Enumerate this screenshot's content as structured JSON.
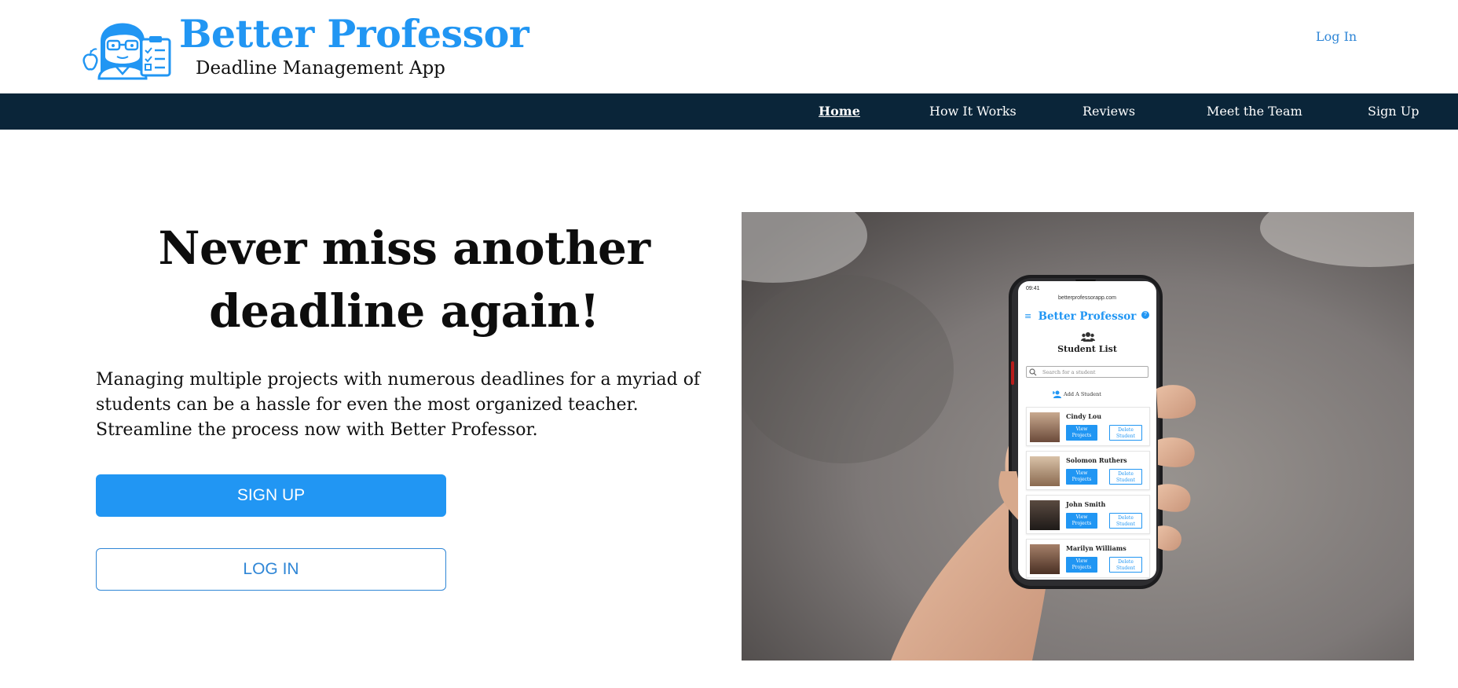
{
  "brand": {
    "title": "Better Professor",
    "subtitle": "Deadline Management App",
    "accent_color": "#2196f3",
    "logo_icon": "teacher-with-checklist-icon"
  },
  "header": {
    "login_label": "Log In"
  },
  "nav": {
    "background_color": "#0a2539",
    "items": [
      {
        "label": "Home",
        "active": true
      },
      {
        "label": "How It Works",
        "active": false
      },
      {
        "label": "Reviews",
        "active": false
      },
      {
        "label": "Meet the Team",
        "active": false
      },
      {
        "label": "Sign Up",
        "active": false
      }
    ]
  },
  "hero": {
    "heading_line1": "Never miss another",
    "heading_line2": "deadline again!",
    "description_line1": "Managing multiple projects with numerous deadlines for a myriad of",
    "description_line2": "students can be a hassle for even the most organized teacher.",
    "description_line3": "Streamline the process now with Better Professor.",
    "signup_label": "SIGN UP",
    "login_label": "LOG IN"
  },
  "phone_screen": {
    "time": "09:41",
    "url": "betterprofessorapp.com",
    "app_title": "Better Professor",
    "list_title": "Student List",
    "search_placeholder": "Search for a student",
    "add_student_label": "Add A Student",
    "view_label_line1": "View",
    "view_label_line2": "Projects",
    "delete_label_line1": "Delete",
    "delete_label_line2": "Student",
    "students": [
      {
        "name": "Cindy Lou"
      },
      {
        "name": "Solomon Ruthers"
      },
      {
        "name": "John Smith"
      },
      {
        "name": "Marilyn Williams"
      }
    ]
  }
}
